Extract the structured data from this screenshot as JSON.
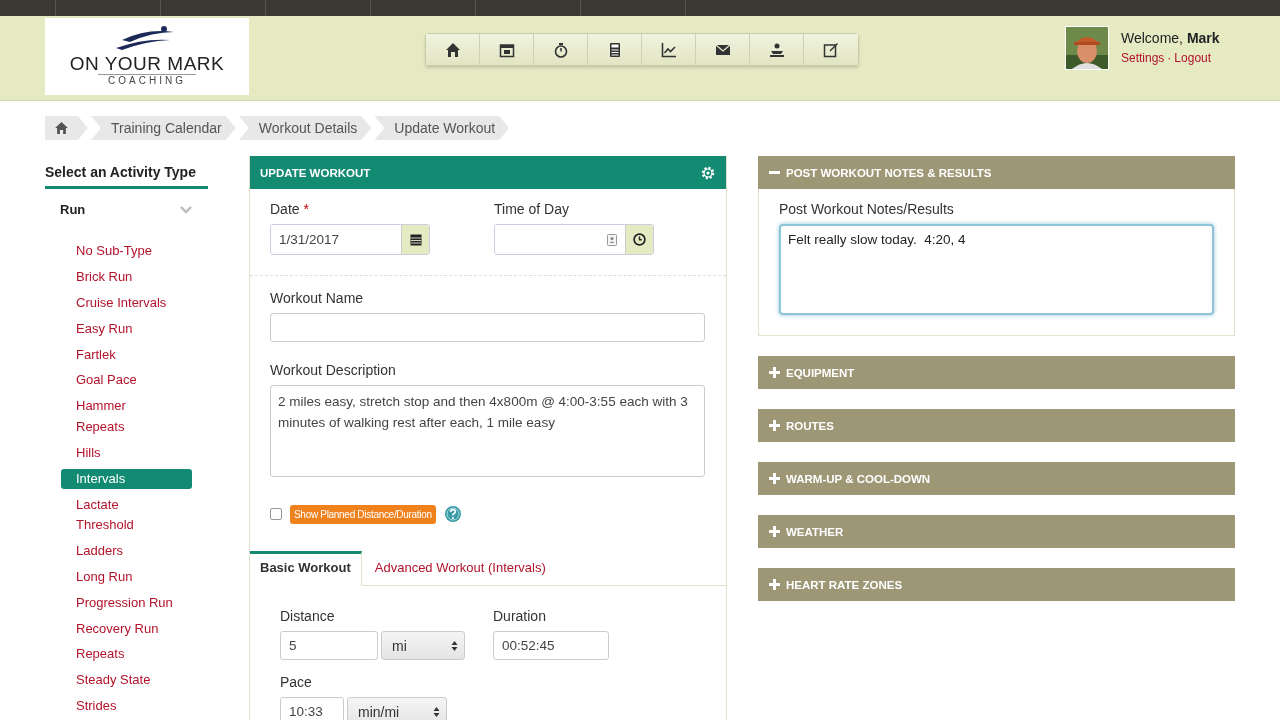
{
  "header": {
    "logo": {
      "title": "ON YOUR MARK",
      "subtitle": "COACHING"
    },
    "welcome": "Welcome,",
    "user": "Mark",
    "links": [
      "Settings",
      "Logout"
    ],
    "link_separator": "·"
  },
  "breadcrumb": [
    "Training Calendar",
    "Workout Details",
    "Update Workout"
  ],
  "sidebar": {
    "title": "Select an Activity Type",
    "activity": "Run",
    "items": [
      {
        "label": "No Sub-Type",
        "selected": false
      },
      {
        "label": "Brick Run",
        "selected": false
      },
      {
        "label": "Cruise Intervals",
        "selected": false
      },
      {
        "label": "Easy Run",
        "selected": false
      },
      {
        "label": "Fartlek",
        "selected": false
      },
      {
        "label": "Goal Pace",
        "selected": false
      },
      {
        "label": "Hammer Repeats",
        "selected": false
      },
      {
        "label": "Hills",
        "selected": false
      },
      {
        "label": "Intervals",
        "selected": true
      },
      {
        "label": "Lactate Threshold",
        "selected": false
      },
      {
        "label": "Ladders",
        "selected": false
      },
      {
        "label": "Long Run",
        "selected": false
      },
      {
        "label": "Progression Run",
        "selected": false
      },
      {
        "label": "Recovery Run",
        "selected": false
      },
      {
        "label": "Repeats",
        "selected": false
      },
      {
        "label": "Steady State",
        "selected": false
      },
      {
        "label": "Strides",
        "selected": false
      }
    ]
  },
  "form": {
    "title": "UPDATE WORKOUT",
    "date_label": "Date",
    "required_mark": "*",
    "date": "1/31/2017",
    "time_label": "Time of Day",
    "name_label": "Workout Name",
    "description_label": "Workout Description",
    "description": "2 miles easy, stretch stop and then 4x800m @ 4:00-3:55 each with 3 minutes of walking rest after each, 1 mile easy",
    "show_planned": {
      "label": "Show Planned Distance/Duration",
      "checked": false
    },
    "tabs": [
      {
        "label": "Basic Workout",
        "selected": true
      },
      {
        "label": "Advanced Workout (Intervals)",
        "selected": false
      }
    ],
    "distance_label": "Distance",
    "distance": "5",
    "distance_unit": "mi",
    "duration_label": "Duration",
    "duration": "00:52:45",
    "pace_label": "Pace",
    "pace": "10:33",
    "pace_unit": "min/mi"
  },
  "sections": [
    {
      "title": "POST WORKOUT NOTES & RESULTS",
      "expanded": true,
      "field_label": "Post Workout Notes/Results",
      "value": "Felt really slow today.  4:20, 4"
    },
    {
      "title": "EQUIPMENT",
      "expanded": false
    },
    {
      "title": "ROUTES",
      "expanded": false
    },
    {
      "title": "WARM-UP & COOL-DOWN",
      "expanded": false
    },
    {
      "title": "WEATHER",
      "expanded": false
    },
    {
      "title": "HEART RATE ZONES",
      "expanded": false
    }
  ]
}
